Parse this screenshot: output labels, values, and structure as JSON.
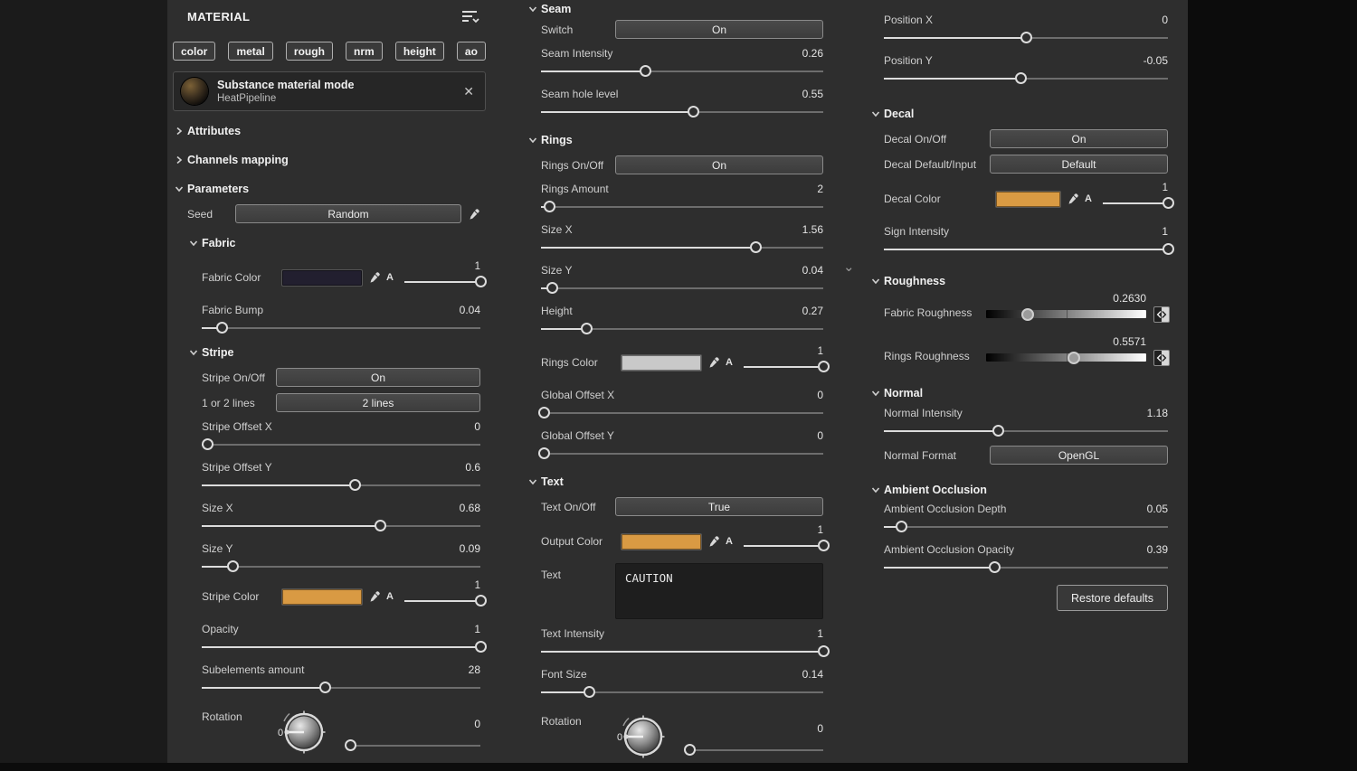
{
  "icons": {
    "close": "✕",
    "chevron_down": "⌄"
  },
  "colors": {
    "accent_orange": "#d99a43",
    "panel_background": "#2e2e2e",
    "fabric_color_swatch": "#221f2f",
    "rings_color_swatch": "#c9c9c9"
  },
  "panel": {
    "title": "MATERIAL",
    "channel_chips": [
      "color",
      "metal",
      "rough",
      "nrm",
      "height",
      "ao"
    ],
    "material_card": {
      "title": "Substance material mode",
      "subtitle": "HeatPipeline"
    },
    "columns": {
      "left": {
        "rows": [
          {
            "type": "collapsible",
            "label": "Attributes",
            "expanded": false
          },
          {
            "type": "collapsible",
            "label": "Channels mapping",
            "expanded": false
          },
          {
            "type": "collapsible",
            "label": "Parameters",
            "expanded": true
          },
          {
            "type": "seed",
            "label": "Seed",
            "value": "Random"
          },
          {
            "type": "collapsible",
            "label": "Fabric",
            "expanded": true,
            "indent": 1
          },
          {
            "type": "color",
            "label": "Fabric Color",
            "swatch": "#221f2f",
            "alpha_label": "A",
            "alpha_value": "1",
            "alpha_pos": 1,
            "indent": 1
          },
          {
            "type": "slider",
            "label": "Fabric Bump",
            "value": "0.04",
            "pos": 0.07,
            "indent": 1
          },
          {
            "type": "collapsible",
            "label": "Stripe",
            "expanded": true,
            "indent": 1
          },
          {
            "type": "toggle",
            "label": "Stripe On/Off",
            "value": "On",
            "indent": 1
          },
          {
            "type": "toggle",
            "label": "1 or 2 lines",
            "value": "2 lines",
            "indent": 1
          },
          {
            "type": "slider",
            "label": "Stripe Offset X",
            "value": "0",
            "pos": 0.02,
            "indent": 1
          },
          {
            "type": "slider",
            "label": "Stripe Offset Y",
            "value": "0.6",
            "pos": 0.55,
            "indent": 1
          },
          {
            "type": "slider",
            "label": "Size X",
            "value": "0.68",
            "pos": 0.64,
            "indent": 1
          },
          {
            "type": "slider",
            "label": "Size Y",
            "value": "0.09",
            "pos": 0.11,
            "indent": 1
          },
          {
            "type": "color",
            "label": "Stripe Color",
            "swatch": "#d99a43",
            "alpha_label": "A",
            "alpha_value": "1",
            "alpha_pos": 1,
            "indent": 1
          },
          {
            "type": "slider",
            "label": "Opacity",
            "value": "1",
            "pos": 1,
            "indent": 1
          },
          {
            "type": "slider",
            "label": "Subelements amount",
            "value": "28",
            "pos": 0.44,
            "indent": 1
          },
          {
            "type": "dial",
            "label": "Rotation",
            "value": "0",
            "pos": 0.02,
            "dial_zero": "0",
            "indent": 1
          }
        ]
      },
      "middle": {
        "rows": [
          {
            "type": "collapsible",
            "label": "Seam",
            "expanded": true
          },
          {
            "type": "toggle",
            "label": "Switch",
            "value": "On"
          },
          {
            "type": "slider",
            "label": "Seam Intensity",
            "value": "0.26",
            "pos": 0.37
          },
          {
            "type": "slider",
            "label": "Seam hole level",
            "value": "0.55",
            "pos": 0.54
          },
          {
            "type": "collapsible",
            "label": "Rings",
            "expanded": true
          },
          {
            "type": "toggle",
            "label": "Rings On/Off",
            "value": "On"
          },
          {
            "type": "slider",
            "label": "Rings Amount",
            "value": "2",
            "pos": 0.03
          },
          {
            "type": "slider",
            "label": "Size X",
            "value": "1.56",
            "pos": 0.76
          },
          {
            "type": "slider",
            "label": "Size Y",
            "value": "0.04",
            "pos": 0.04
          },
          {
            "type": "slider",
            "label": "Height",
            "value": "0.27",
            "pos": 0.16
          },
          {
            "type": "color",
            "label": "Rings Color",
            "swatch": "#c9c9c9",
            "alpha_label": "A",
            "alpha_value": "1",
            "alpha_pos": 1
          },
          {
            "type": "slider",
            "label": "Global Offset X",
            "value": "0",
            "pos": 0.01
          },
          {
            "type": "slider",
            "label": "Global Offset Y",
            "value": "0",
            "pos": 0.01
          },
          {
            "type": "collapsible",
            "label": "Text",
            "expanded": true
          },
          {
            "type": "toggle",
            "label": "Text On/Off",
            "value": "True"
          },
          {
            "type": "color",
            "label": "Output Color",
            "swatch": "#d99a43",
            "alpha_label": "A",
            "alpha_value": "1",
            "alpha_pos": 1
          },
          {
            "type": "textarea",
            "label": "Text",
            "value": "CAUTION"
          },
          {
            "type": "slider",
            "label": "Text Intensity",
            "value": "1",
            "pos": 1
          },
          {
            "type": "slider",
            "label": "Font Size",
            "value": "0.14",
            "pos": 0.17
          },
          {
            "type": "dial",
            "label": "Rotation",
            "value": "0",
            "pos": 0.02,
            "dial_zero": "0"
          }
        ]
      },
      "right": {
        "rows": [
          {
            "type": "slider",
            "label": "Position X",
            "value": "0",
            "pos": 0.5
          },
          {
            "type": "slider",
            "label": "Position Y",
            "value": "-0.05",
            "pos": 0.48
          },
          {
            "type": "collapsible",
            "label": "Decal",
            "expanded": true
          },
          {
            "type": "toggle",
            "label": "Decal On/Off",
            "value": "On"
          },
          {
            "type": "toggle",
            "label": "Decal Default/Input",
            "value": "Default"
          },
          {
            "type": "color",
            "label": "Decal Color",
            "swatch": "#d99a43",
            "alpha_label": "A",
            "alpha_value": "1",
            "alpha_pos": 1
          },
          {
            "type": "slider",
            "label": "Sign Intensity",
            "value": "1",
            "pos": 1
          },
          {
            "type": "collapsible",
            "label": "Roughness",
            "expanded": true
          },
          {
            "type": "gslider",
            "label": "Fabric Roughness",
            "value": "0.2630",
            "pos": 0.26
          },
          {
            "type": "gslider",
            "label": "Rings Roughness",
            "value": "0.5571",
            "pos": 0.55
          },
          {
            "type": "collapsible",
            "label": "Normal",
            "expanded": true
          },
          {
            "type": "slider",
            "label": "Normal Intensity",
            "value": "1.18",
            "pos": 0.4
          },
          {
            "type": "toggle",
            "label": "Normal Format",
            "value": "OpenGL"
          },
          {
            "type": "collapsible",
            "label": "Ambient Occlusion",
            "expanded": true
          },
          {
            "type": "slider",
            "label": "Ambient Occlusion Depth",
            "value": "0.05",
            "pos": 0.06
          },
          {
            "type": "slider",
            "label": "Ambient Occlusion Opacity",
            "value": "0.39",
            "pos": 0.39
          },
          {
            "type": "button",
            "label": "Restore defaults"
          }
        ]
      }
    }
  }
}
